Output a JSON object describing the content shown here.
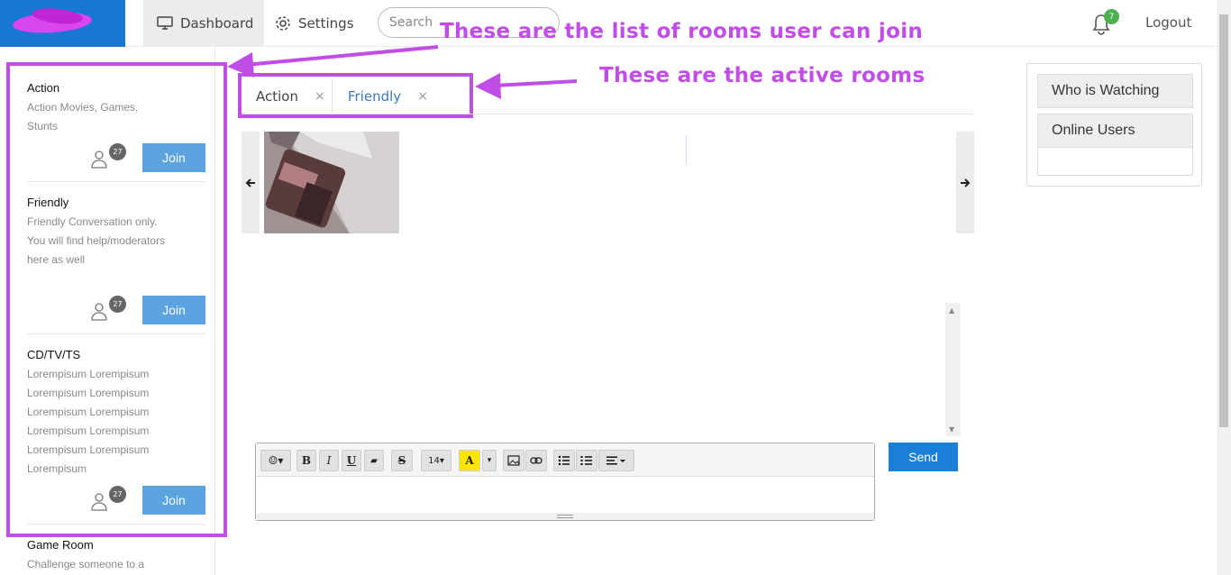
{
  "header": {
    "nav": {
      "dashboard_label": "Dashboard",
      "settings_label": "Settings"
    },
    "search": {
      "placeholder": "Search"
    },
    "notifications": {
      "count": "7"
    },
    "logout_label": "Logout"
  },
  "sidebar": {
    "rooms": [
      {
        "title": "Action",
        "description": "Action Movies, Games, Stunts",
        "user_count": "27",
        "join_label": "Join"
      },
      {
        "title": "Friendly",
        "description": "Friendly Conversation only. You will find help/moderators here as well",
        "user_count": "27",
        "join_label": "Join"
      },
      {
        "title": "CD/TV/TS",
        "description": "Lorempisum Lorempisum Lorempisum Lorempisum Lorempisum Lorempisum Lorempisum Lorempisum Lorempisum Lorempisum Lorempisum",
        "user_count": "27",
        "join_label": "Join"
      },
      {
        "title": "Game Room",
        "description": "Challenge someone to a"
      }
    ]
  },
  "tabs": [
    {
      "label": "Action",
      "close": "×",
      "color": "#444444"
    },
    {
      "label": "Friendly",
      "close": "×",
      "color": "#3a78c2"
    }
  ],
  "carousel": {
    "prev_icon": "arrow-left-icon",
    "next_icon": "arrow-right-icon"
  },
  "editor": {
    "toolbar": {
      "emoji": "☺▾",
      "bold": "B",
      "italic": "I",
      "underline": "U",
      "eraser": "▰",
      "strike": "S",
      "font_size": "14▾",
      "font_color": "A",
      "color_caret": "▾",
      "image": "picture-icon",
      "link": "link-icon",
      "ul": "bullet-list-icon",
      "ol": "numbered-list-icon",
      "align": "align-icon"
    },
    "send_label": "Send"
  },
  "right_panel": {
    "who_watching_label": "Who is Watching",
    "online_users_label": "Online Users"
  },
  "annotations": {
    "rooms_list": "These are the list of rooms user can join",
    "active_rooms": "These are the active rooms",
    "color": "#c04ee6"
  },
  "colors": {
    "brand": "#1976d2",
    "join_button": "#5ba4e0",
    "send_button": "#1a7fd6",
    "notification_badge": "#4caf50"
  }
}
